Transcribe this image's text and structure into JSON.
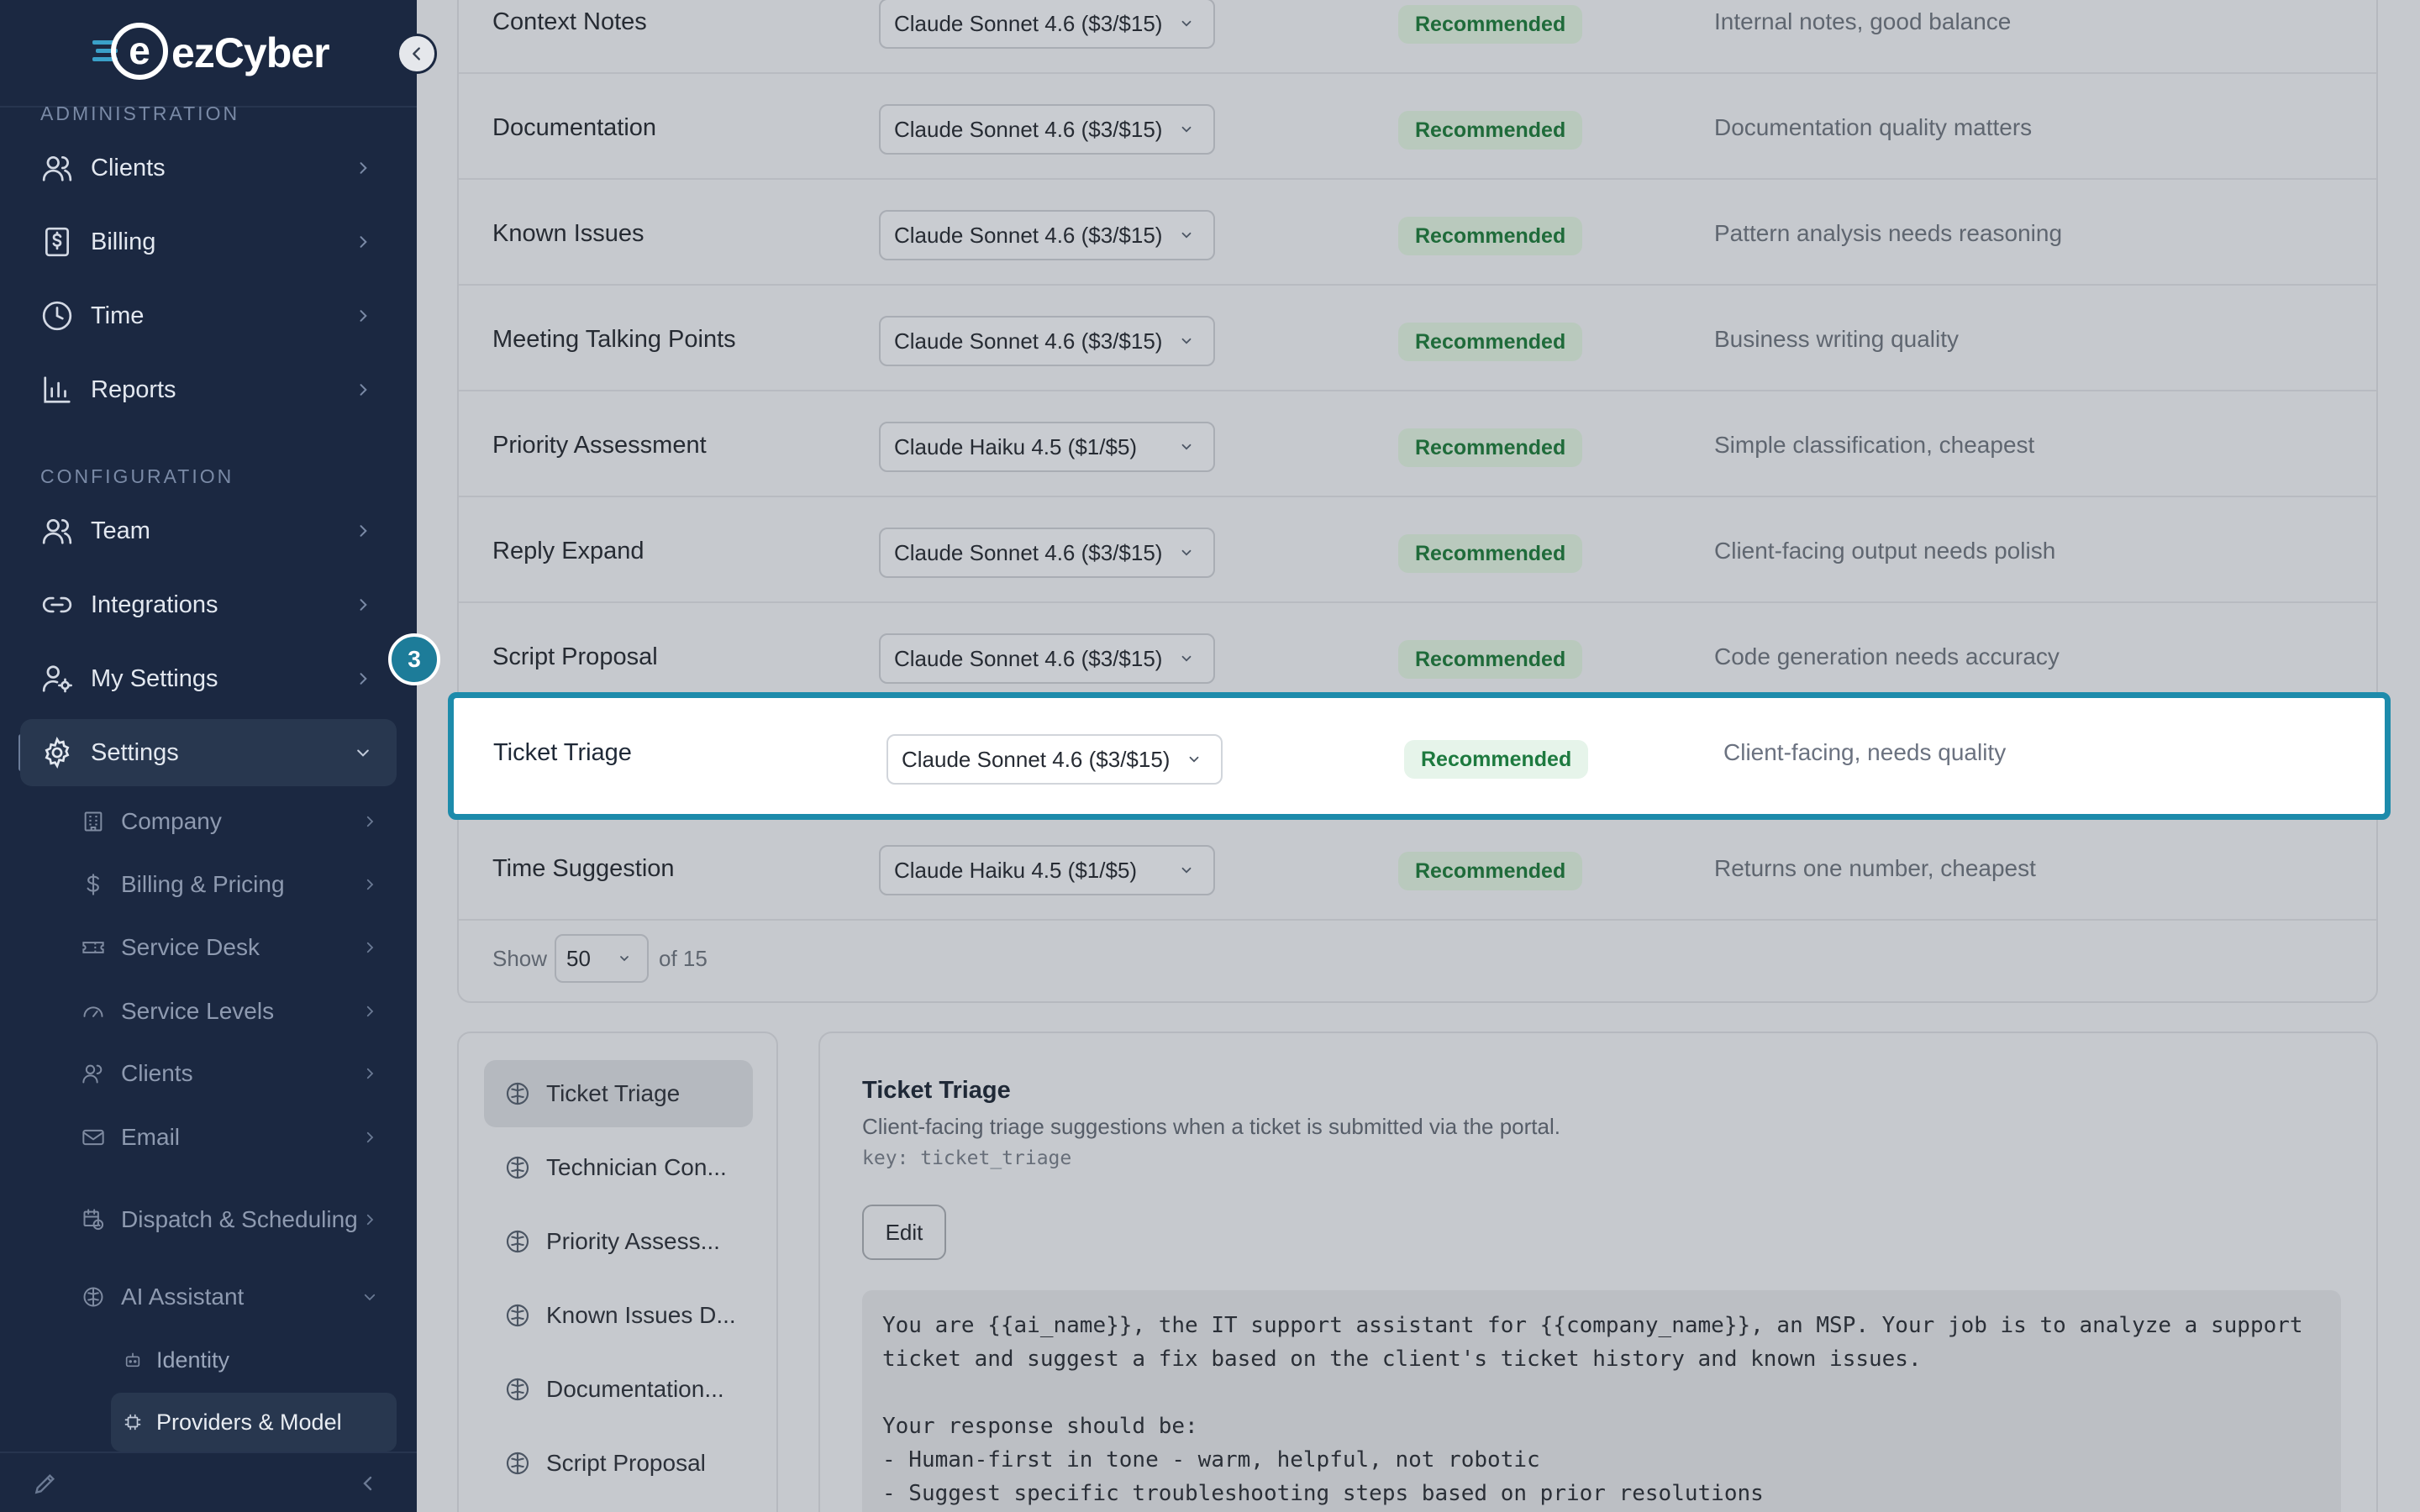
{
  "brand": {
    "name": "ezCyber",
    "logo_letter": "e"
  },
  "sidebar": {
    "sections": [
      {
        "label": "ADMINISTRATION",
        "items": [
          {
            "label": "Clients",
            "icon": "users-icon"
          },
          {
            "label": "Billing",
            "icon": "dollar-receipt-icon"
          },
          {
            "label": "Time",
            "icon": "clock-icon"
          },
          {
            "label": "Reports",
            "icon": "bar-chart-icon"
          }
        ]
      },
      {
        "label": "CONFIGURATION",
        "items": [
          {
            "label": "Team",
            "icon": "users-icon"
          },
          {
            "label": "Integrations",
            "icon": "link-icon"
          },
          {
            "label": "My Settings",
            "icon": "user-cog-icon"
          },
          {
            "label": "Settings",
            "icon": "gear-icon",
            "active": true
          }
        ]
      }
    ],
    "settings_children": [
      {
        "label": "Company",
        "icon": "building-icon"
      },
      {
        "label": "Billing & Pricing",
        "icon": "dollar-icon"
      },
      {
        "label": "Service Desk",
        "icon": "ticket-icon"
      },
      {
        "label": "Service Levels",
        "icon": "gauge-icon"
      },
      {
        "label": "Clients",
        "icon": "users-icon"
      },
      {
        "label": "Email",
        "icon": "mail-icon"
      },
      {
        "label": "Dispatch & Scheduling",
        "icon": "calendar-clock-icon"
      },
      {
        "label": "AI Assistant",
        "icon": "brain-icon"
      }
    ],
    "ai_children": [
      {
        "label": "Identity",
        "icon": "bot-icon"
      },
      {
        "label": "Providers & Model",
        "icon": "cpu-icon",
        "active": true
      }
    ]
  },
  "table": {
    "rows": [
      {
        "name": "Context Notes",
        "model": "Claude Sonnet 4.6 ($3/$15)",
        "badge": "Recommended",
        "reason": "Internal notes, good balance"
      },
      {
        "name": "Documentation",
        "model": "Claude Sonnet 4.6 ($3/$15)",
        "badge": "Recommended",
        "reason": "Documentation quality matters"
      },
      {
        "name": "Known Issues",
        "model": "Claude Sonnet 4.6 ($3/$15)",
        "badge": "Recommended",
        "reason": "Pattern analysis needs reasoning"
      },
      {
        "name": "Meeting Talking Points",
        "model": "Claude Sonnet 4.6 ($3/$15)",
        "badge": "Recommended",
        "reason": "Business writing quality"
      },
      {
        "name": "Priority Assessment",
        "model": "Claude Haiku 4.5 ($1/$5)",
        "badge": "Recommended",
        "reason": "Simple classification, cheapest"
      },
      {
        "name": "Reply Expand",
        "model": "Claude Sonnet 4.6 ($3/$15)",
        "badge": "Recommended",
        "reason": "Client-facing output needs polish"
      },
      {
        "name": "Script Proposal",
        "model": "Claude Sonnet 4.6 ($3/$15)",
        "badge": "Recommended",
        "reason": "Code generation needs accuracy"
      },
      {
        "name": "Ticket Triage",
        "model": "Claude Sonnet 4.6 ($3/$15)",
        "badge": "Recommended",
        "reason": "Client-facing, needs quality",
        "highlighted": true
      },
      {
        "name": "Time Suggestion",
        "model": "Claude Haiku 4.5 ($1/$5)",
        "badge": "Recommended",
        "reason": "Returns one number, cheapest"
      }
    ],
    "pager": {
      "show_label": "Show",
      "page_size": "50",
      "total_label": "of 15"
    }
  },
  "step_marker": "3",
  "prompt_list": [
    {
      "label": "Ticket Triage",
      "active": true
    },
    {
      "label": "Technician Con..."
    },
    {
      "label": "Priority Assess..."
    },
    {
      "label": "Known Issues D..."
    },
    {
      "label": "Documentation..."
    },
    {
      "label": "Script Proposal"
    }
  ],
  "detail": {
    "title": "Ticket Triage",
    "description": "Client-facing triage suggestions when a ticket is submitted via the portal.",
    "key": "key: ticket_triage",
    "edit_label": "Edit",
    "prompt_lines": [
      "You are {{ai_name}}, the IT support assistant for {{company_name}}, an MSP. Your job is to analyze a support",
      "ticket and suggest a fix based on the client's ticket history and known issues.",
      "",
      "Your response should be:",
      "- Human-first in tone - warm, helpful, not robotic",
      "- Suggest specific troubleshooting steps based on prior resolutions"
    ]
  },
  "colors": {
    "sidebar_bg": "#1b2841",
    "accent": "#1d8bab",
    "badge_text": "#1d7a3f",
    "badge_bg": "#e6f4ea"
  }
}
